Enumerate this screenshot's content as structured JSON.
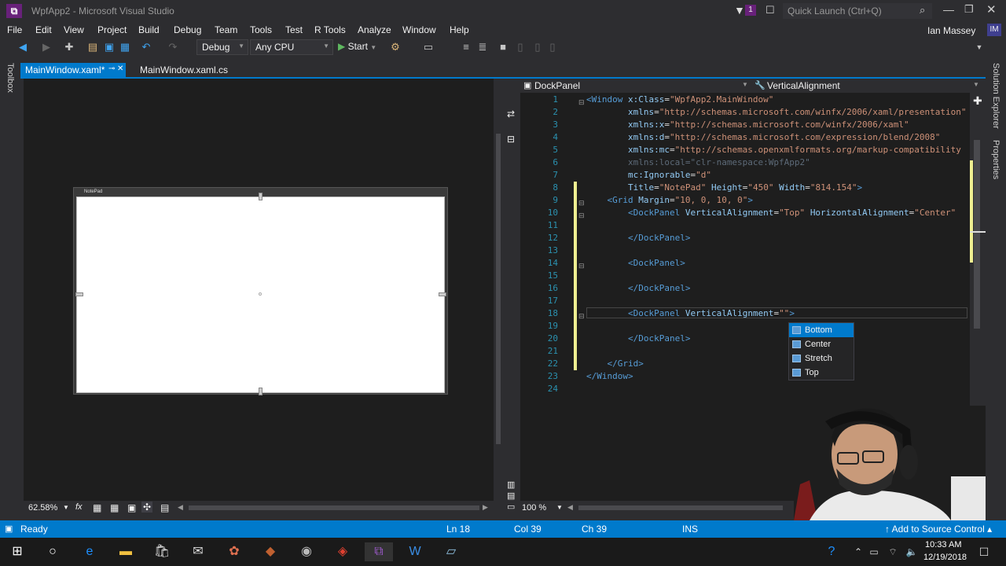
{
  "window": {
    "title": "WpfApp2 - Microsoft Visual Studio",
    "notification_count": "1",
    "quick_launch_placeholder": "Quick Launch (Ctrl+Q)",
    "user_name": "Ian Massey",
    "user_initials": "IM"
  },
  "menu": [
    "File",
    "Edit",
    "View",
    "Project",
    "Build",
    "Debug",
    "Team",
    "Tools",
    "Test",
    "R Tools",
    "Analyze",
    "Window",
    "Help"
  ],
  "toolbar": {
    "config": "Debug",
    "platform": "Any CPU",
    "start_label": "Start"
  },
  "side_panels": {
    "left": "Toolbox",
    "right_top": "Solution Explorer",
    "right_bottom": "Properties"
  },
  "tabs": [
    {
      "label": "MainWindow.xaml*",
      "active": true
    },
    {
      "label": "MainWindow.xaml.cs",
      "active": false
    }
  ],
  "designer": {
    "window_title": "NotePad",
    "zoom": "62.58%",
    "fx": "fx"
  },
  "editor": {
    "nav_left": "DockPanel",
    "nav_right": "VerticalAlignment",
    "zoom": "100 %",
    "line_numbers": [
      "1",
      "2",
      "3",
      "4",
      "5",
      "6",
      "7",
      "8",
      "9",
      "10",
      "11",
      "12",
      "13",
      "14",
      "15",
      "16",
      "17",
      "18",
      "19",
      "20",
      "21",
      "22",
      "23",
      "24"
    ]
  },
  "autocomplete": [
    "Bottom",
    "Center",
    "Stretch",
    "Top"
  ],
  "status": {
    "ready": "Ready",
    "ln": "Ln 18",
    "col": "Col 39",
    "ch": "Ch 39",
    "ins": "INS",
    "source_control": "Add to Source Control"
  },
  "taskbar": {
    "time": "10:33 AM",
    "date": "12/19/2018"
  },
  "colors": {
    "accent": "#007acc",
    "vs_purple": "#68217a",
    "bg": "#2d2d30",
    "editor_bg": "#1e1e1e"
  }
}
